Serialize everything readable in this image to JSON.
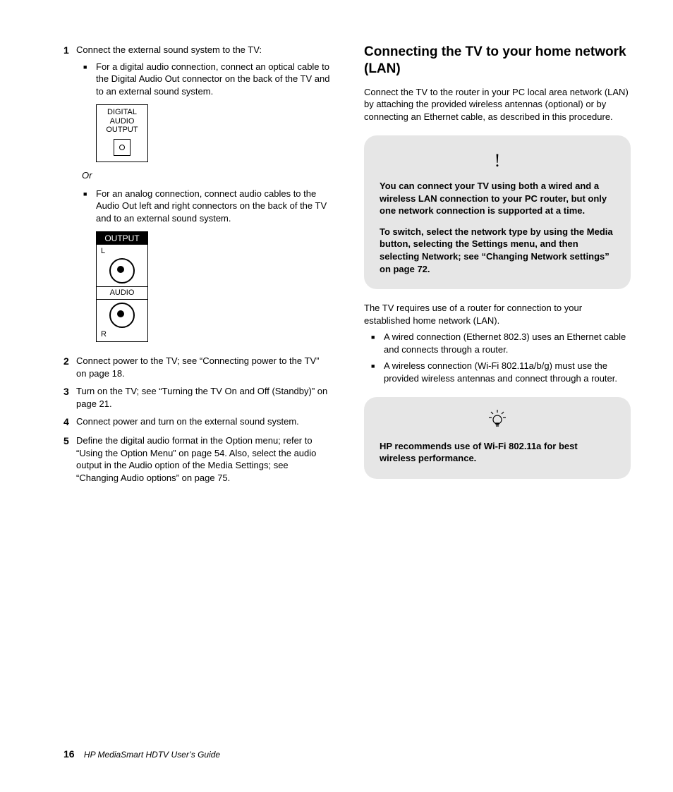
{
  "left": {
    "step1": {
      "num": "1",
      "text": "Connect the external sound system to the TV:",
      "bullets": [
        "For a digital audio connection, connect an optical cable to the Digital Audio Out connector on the back of the TV and to an external sound system.",
        "For an analog connection, connect audio cables to the Audio Out left and right connectors on the back of the TV and to an external sound system."
      ],
      "or": "Or",
      "dig_label_1": "DIGITAL",
      "dig_label_2": "AUDIO",
      "dig_label_3": "OUTPUT",
      "analog_head": "OUTPUT",
      "analog_l": "L",
      "analog_mid": "AUDIO",
      "analog_r": "R"
    },
    "step2": {
      "num": "2",
      "text": "Connect power to the TV; see “Connecting power to the TV” on page 18."
    },
    "step3": {
      "num": "3",
      "text": "Turn on the TV; see “Turning the TV On and Off (Standby)” on page 21."
    },
    "step4": {
      "num": "4",
      "text": "Connect power and turn on the external sound system."
    },
    "step5": {
      "num": "5",
      "text": "Define the digital audio format in the Option menu; refer to “Using the Option Menu” on page 54. Also, select the audio output in the Audio option of the Media Settings; see “Changing Audio options” on page 75."
    }
  },
  "right": {
    "heading": "Connecting the TV to your home network (LAN)",
    "intro": "Connect the TV to the router in your PC local area network (LAN) by attaching the provided wireless antennas (optional) or by connecting an Ethernet cable, as described in this procedure.",
    "warn1": "You can connect your TV using both a wired and a wireless LAN connection to your PC router, but only one network connection is supported at a time.",
    "warn2": "To switch, select the network type by using the Media button, selecting the Settings menu, and then selecting Network; see “Changing Network settings” on page 72.",
    "after": "The TV requires use of a router for connection to your established home network (LAN).",
    "bullets": [
      "A wired connection (Ethernet 802.3) uses an Ethernet cable and connects through a router.",
      "A wireless connection (Wi-Fi 802.11a/b/g) must use the provided wireless antennas and connect through a router."
    ],
    "tip": "HP recommends use of Wi-Fi 802.11a for best wireless performance."
  },
  "footer": {
    "page": "16",
    "title": "HP MediaSmart HDTV User’s Guide"
  }
}
